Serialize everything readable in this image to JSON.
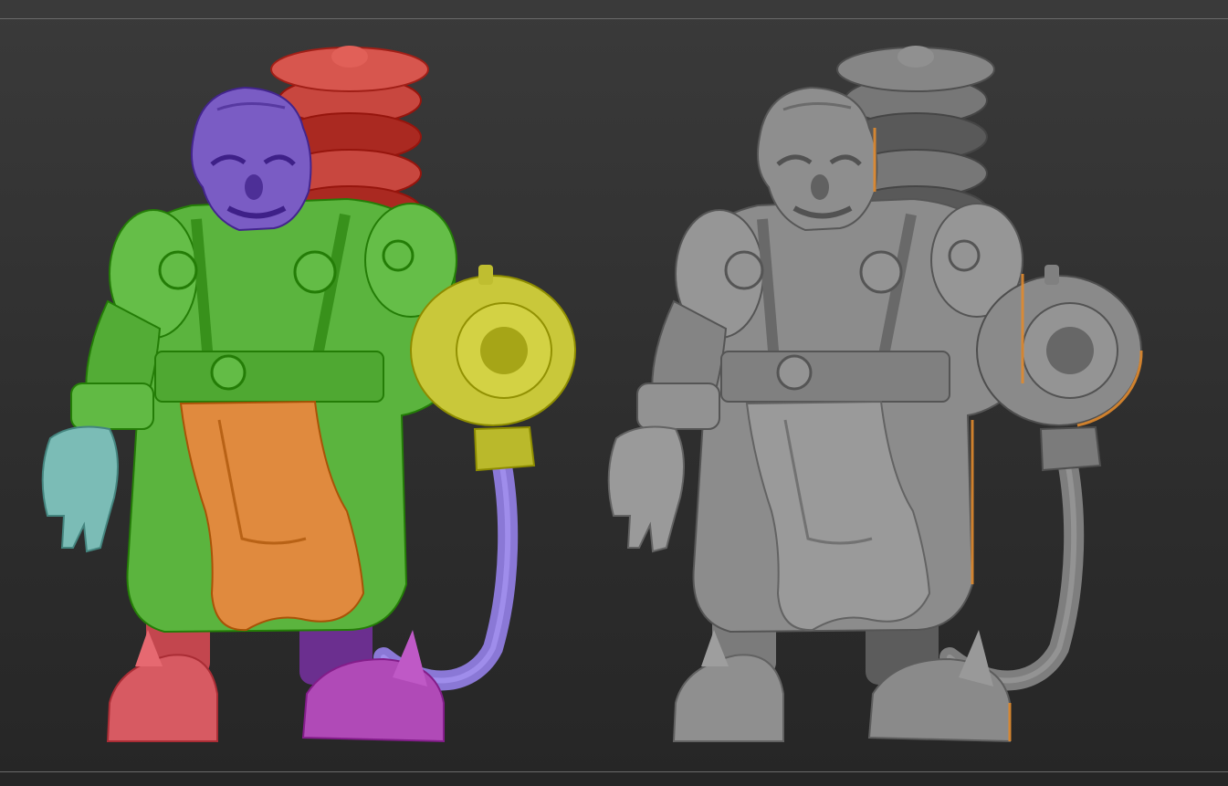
{
  "scene": {
    "background_top": "#3a3a3a",
    "background_bottom": "#262626",
    "frame_line_color": "#6a6a6a"
  },
  "figures": [
    {
      "id": "polygroup-view",
      "palette": {
        "head": "#7a5cc4",
        "tank": "#c8473f",
        "body": "#5bb43e",
        "apron": "#e08a3e",
        "weapon": "#c9c83a",
        "hose": "#8a78d6",
        "hand": "#7bbcb6",
        "left_boot": "#d75a62",
        "right_boot": "#b04ab7",
        "right_leg": "#6b2f8f"
      }
    },
    {
      "id": "clay-render-view",
      "palette": {
        "head": "#8e8e8e",
        "tank": "#777777",
        "body": "#8c8c8c",
        "apron": "#9a9a9a",
        "weapon": "#8a8a8a",
        "hose": "#7e7e7e",
        "hand": "#9a9a9a",
        "left_boot": "#8f8f8f",
        "right_boot": "#8a8a8a",
        "right_leg": "#5c5c5c",
        "rim_light": "#e08a2e"
      }
    }
  ]
}
